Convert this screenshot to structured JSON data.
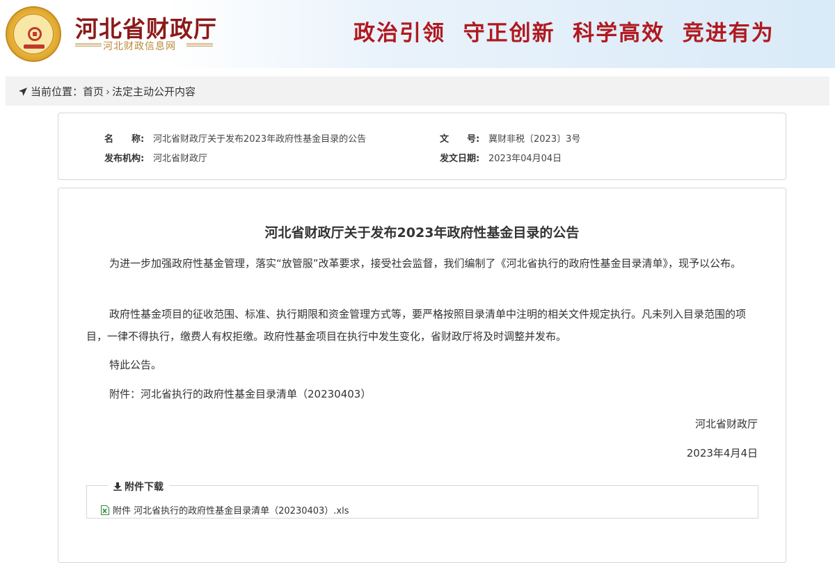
{
  "header": {
    "site_title": "河北省财政厅",
    "site_subtitle": "河北财政信息网",
    "slogan": "政治引领  守正创新  科学高效  竞进有为",
    "colors": {
      "title": "#8b1a1a",
      "slogan": "#b0191f",
      "subtitle": "#b8893a"
    }
  },
  "breadcrumb": {
    "prefix": "当前位置：",
    "home": "首页",
    "separator": "›",
    "current": "法定主动公开内容"
  },
  "meta": {
    "name_label": "名　　称:",
    "name_value": "河北省财政厅关于发布2023年政府性基金目录的公告",
    "doc_no_label": "文　　号:",
    "doc_no_value": "冀财非税〔2023〕3号",
    "publisher_label": "发布机构:",
    "publisher_value": "河北省财政厅",
    "date_label": "发文日期:",
    "date_value": "2023年04月04日"
  },
  "article": {
    "title": "河北省财政厅关于发布2023年政府性基金目录的公告",
    "paragraphs": [
      "为进一步加强政府性基金管理，落实“放管服”改革要求，接受社会监督，我们编制了《河北省执行的政府性基金目录清单》，现予以公布。",
      "政府性基金项目的征收范围、标准、执行期限和资金管理方式等，要严格按照目录清单中注明的相关文件规定执行。凡未列入目录范围的项目，一律不得执行，缴费人有权拒缴。政府性基金项目在执行中发生变化，省财政厅将及时调整并发布。",
      "特此公告。",
      "附件：河北省执行的政府性基金目录清单（20230403）"
    ],
    "signature": "河北省财政厅",
    "sign_date": "2023年4月4日"
  },
  "attachments": {
    "legend": "附件下载",
    "items": [
      {
        "label": "附件 河北省执行的政府性基金目录清单（20230403）.xls",
        "icon": "excel-file-icon"
      }
    ]
  }
}
